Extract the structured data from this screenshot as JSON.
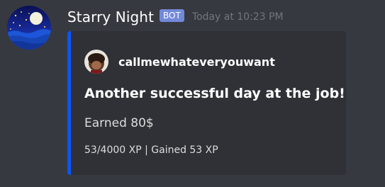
{
  "message": {
    "author": {
      "name": "Starry Night",
      "bot_tag": "BOT",
      "avatar_icon": "starry-night-avatar-icon"
    },
    "timestamp": "Today at 10:23 PM",
    "embed": {
      "color": "#0b55ff",
      "author": {
        "name": "callmewhateveryouwant",
        "icon": "user-avatar-icon"
      },
      "title": "Another successful day at the job!",
      "description": "Earned 80$",
      "footer": "53/4000 XP | Gained 53 XP"
    }
  },
  "colors": {
    "background": "#36393f",
    "embed_background": "#2f3136",
    "bot_tag": "#7289da",
    "timestamp": "#72767d"
  }
}
